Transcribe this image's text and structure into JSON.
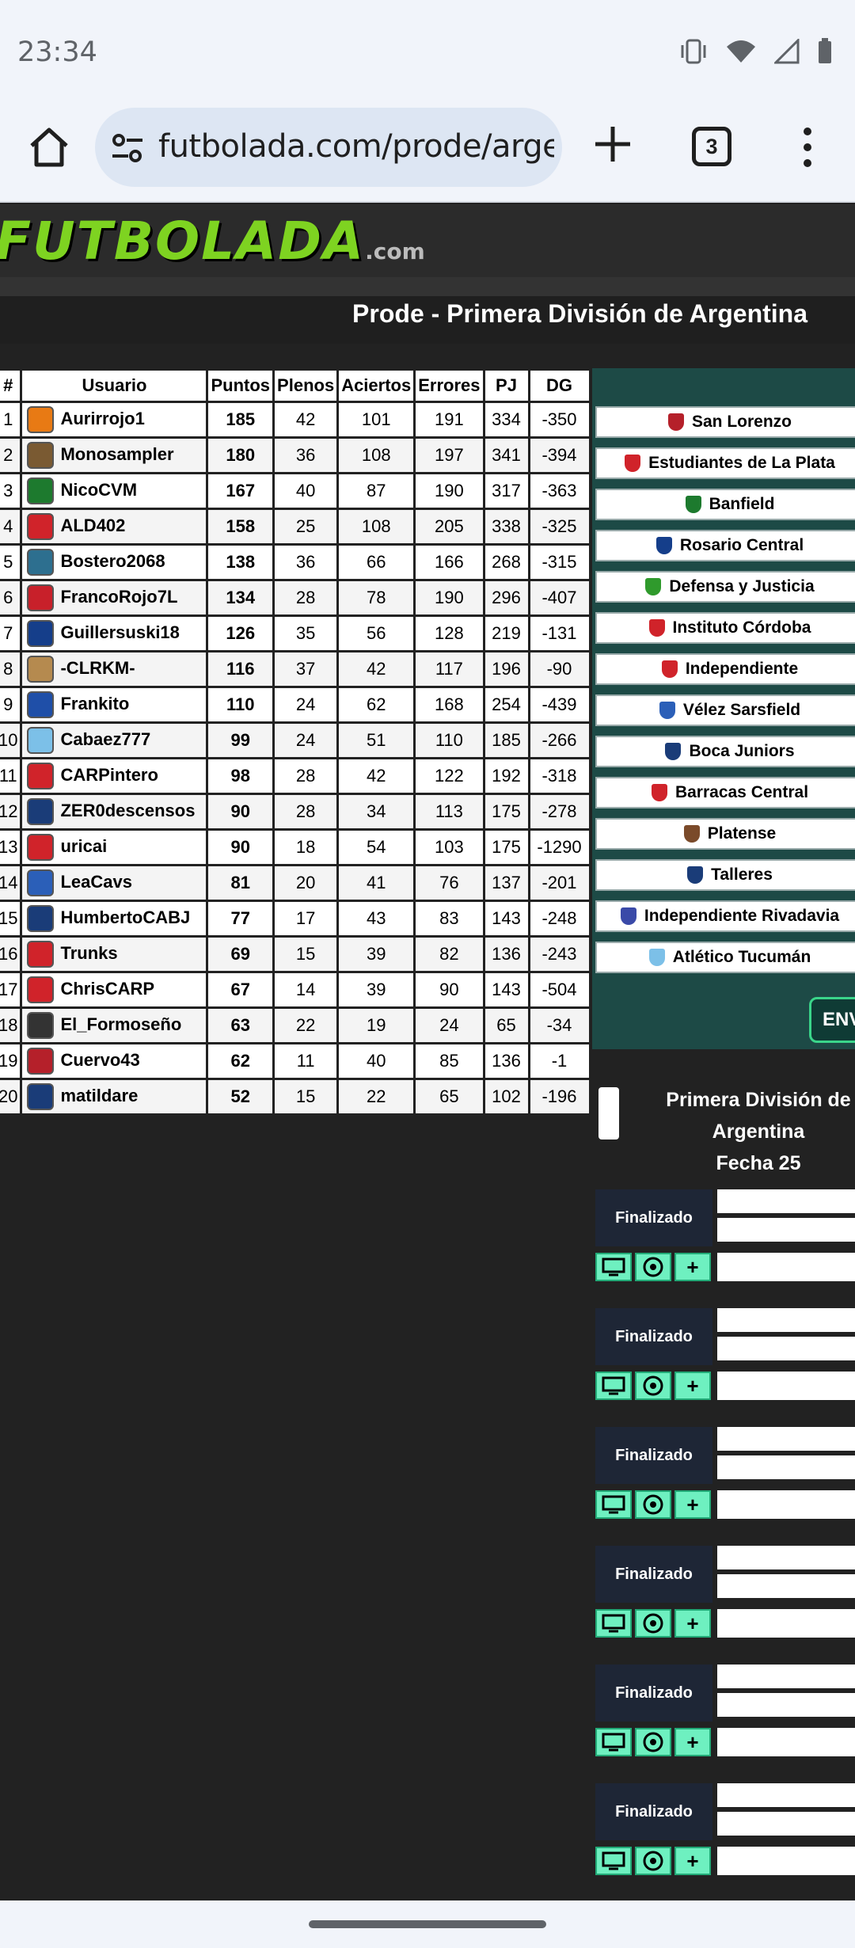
{
  "status": {
    "time": "23:34"
  },
  "browser": {
    "url": "futbolada.com/prode/argen",
    "tab_count": "3"
  },
  "site": {
    "logo": "FUTBOLADA",
    "logo_domain": ".com",
    "page_title": "Prode - Primera División de Argentina"
  },
  "ranking": {
    "headers": [
      "#",
      "Usuario",
      "Puntos",
      "Plenos",
      "Aciertos",
      "Errores",
      "PJ",
      "DG"
    ],
    "rows": [
      {
        "pos": "1",
        "user": "Aurirrojo1",
        "pts": "185",
        "plenos": "42",
        "aciertos": "101",
        "errores": "191",
        "pj": "334",
        "dg": "-350",
        "color": "#e87a14"
      },
      {
        "pos": "2",
        "user": "Monosampler",
        "pts": "180",
        "plenos": "36",
        "aciertos": "108",
        "errores": "197",
        "pj": "341",
        "dg": "-394",
        "color": "#7a5a32"
      },
      {
        "pos": "3",
        "user": "NicoCVM",
        "pts": "167",
        "plenos": "40",
        "aciertos": "87",
        "errores": "190",
        "pj": "317",
        "dg": "-363",
        "color": "#1d7a2e"
      },
      {
        "pos": "4",
        "user": "ALD402",
        "pts": "158",
        "plenos": "25",
        "aciertos": "108",
        "errores": "205",
        "pj": "338",
        "dg": "-325",
        "color": "#d0232a"
      },
      {
        "pos": "5",
        "user": "Bostero2068",
        "pts": "138",
        "plenos": "36",
        "aciertos": "66",
        "errores": "166",
        "pj": "268",
        "dg": "-315",
        "color": "#2d6f8f"
      },
      {
        "pos": "6",
        "user": "FrancoRojo7L",
        "pts": "134",
        "plenos": "28",
        "aciertos": "78",
        "errores": "190",
        "pj": "296",
        "dg": "-407",
        "color": "#c8202a"
      },
      {
        "pos": "7",
        "user": "Guillersuski18",
        "pts": "126",
        "plenos": "35",
        "aciertos": "56",
        "errores": "128",
        "pj": "219",
        "dg": "-131",
        "color": "#153e8a"
      },
      {
        "pos": "8",
        "user": "-CLRKM-",
        "pts": "116",
        "plenos": "37",
        "aciertos": "42",
        "errores": "117",
        "pj": "196",
        "dg": "-90",
        "color": "#b58a4f"
      },
      {
        "pos": "9",
        "user": "Frankito",
        "pts": "110",
        "plenos": "24",
        "aciertos": "62",
        "errores": "168",
        "pj": "254",
        "dg": "-439",
        "color": "#1f4fa8"
      },
      {
        "pos": "10",
        "user": "Cabaez777",
        "pts": "99",
        "plenos": "24",
        "aciertos": "51",
        "errores": "110",
        "pj": "185",
        "dg": "-266",
        "color": "#7cc0e8"
      },
      {
        "pos": "11",
        "user": "CARPintero",
        "pts": "98",
        "plenos": "28",
        "aciertos": "42",
        "errores": "122",
        "pj": "192",
        "dg": "-318",
        "color": "#d0232a"
      },
      {
        "pos": "12",
        "user": "ZER0descensos",
        "pts": "90",
        "plenos": "28",
        "aciertos": "34",
        "errores": "113",
        "pj": "175",
        "dg": "-278",
        "color": "#1a3c78"
      },
      {
        "pos": "13",
        "user": "uricai",
        "pts": "90",
        "plenos": "18",
        "aciertos": "54",
        "errores": "103",
        "pj": "175",
        "dg": "-1290",
        "color": "#d0232a"
      },
      {
        "pos": "14",
        "user": "LeaCavs",
        "pts": "81",
        "plenos": "20",
        "aciertos": "41",
        "errores": "76",
        "pj": "137",
        "dg": "-201",
        "color": "#2b5fb8"
      },
      {
        "pos": "15",
        "user": "HumbertoCABJ",
        "pts": "77",
        "plenos": "17",
        "aciertos": "43",
        "errores": "83",
        "pj": "143",
        "dg": "-248",
        "color": "#1a3c78"
      },
      {
        "pos": "16",
        "user": "Trunks",
        "pts": "69",
        "plenos": "15",
        "aciertos": "39",
        "errores": "82",
        "pj": "136",
        "dg": "-243",
        "color": "#d0232a"
      },
      {
        "pos": "17",
        "user": "ChrisCARP",
        "pts": "67",
        "plenos": "14",
        "aciertos": "39",
        "errores": "90",
        "pj": "143",
        "dg": "-504",
        "color": "#d0232a"
      },
      {
        "pos": "18",
        "user": "El_Formoseño",
        "pts": "63",
        "plenos": "22",
        "aciertos": "19",
        "errores": "24",
        "pj": "65",
        "dg": "-34",
        "color": "#333333"
      },
      {
        "pos": "19",
        "user": "Cuervo43",
        "pts": "62",
        "plenos": "11",
        "aciertos": "40",
        "errores": "85",
        "pj": "136",
        "dg": "-1",
        "color": "#b5202a"
      },
      {
        "pos": "20",
        "user": "matildare",
        "pts": "52",
        "plenos": "15",
        "aciertos": "22",
        "errores": "65",
        "pj": "102",
        "dg": "-196",
        "color": "#1a3c78"
      }
    ]
  },
  "teams": [
    {
      "name": "San Lorenzo",
      "color": "#b5202a"
    },
    {
      "name": "Estudiantes de La Plata",
      "color": "#d0232a"
    },
    {
      "name": "Banfield",
      "color": "#1d7a2e"
    },
    {
      "name": "Rosario Central",
      "color": "#153e8a"
    },
    {
      "name": "Defensa y Justicia",
      "color": "#2f9a2c"
    },
    {
      "name": "Instituto Córdoba",
      "color": "#d0232a"
    },
    {
      "name": "Independiente",
      "color": "#d0232a"
    },
    {
      "name": "Vélez Sarsfield",
      "color": "#2b5fb8"
    },
    {
      "name": "Boca Juniors",
      "color": "#1a3c78"
    },
    {
      "name": "Barracas Central",
      "color": "#d0232a"
    },
    {
      "name": "Platense",
      "color": "#7a4a2a"
    },
    {
      "name": "Talleres",
      "color": "#1a3c78"
    },
    {
      "name": "Independiente Rivadavia",
      "color": "#3a4aa8"
    },
    {
      "name": "Atlético Tucumán",
      "color": "#7cc0e8"
    }
  ],
  "submit_label": "ENV",
  "fecha": {
    "league_lines": [
      "Primera División de",
      "Argentina",
      "Fecha 25"
    ]
  },
  "matches": [
    {
      "status": "Finalizado"
    },
    {
      "status": "Finalizado"
    },
    {
      "status": "Finalizado"
    },
    {
      "status": "Finalizado"
    },
    {
      "status": "Finalizado"
    },
    {
      "status": "Finalizado"
    }
  ],
  "match_buttons": {
    "plus": "+"
  }
}
